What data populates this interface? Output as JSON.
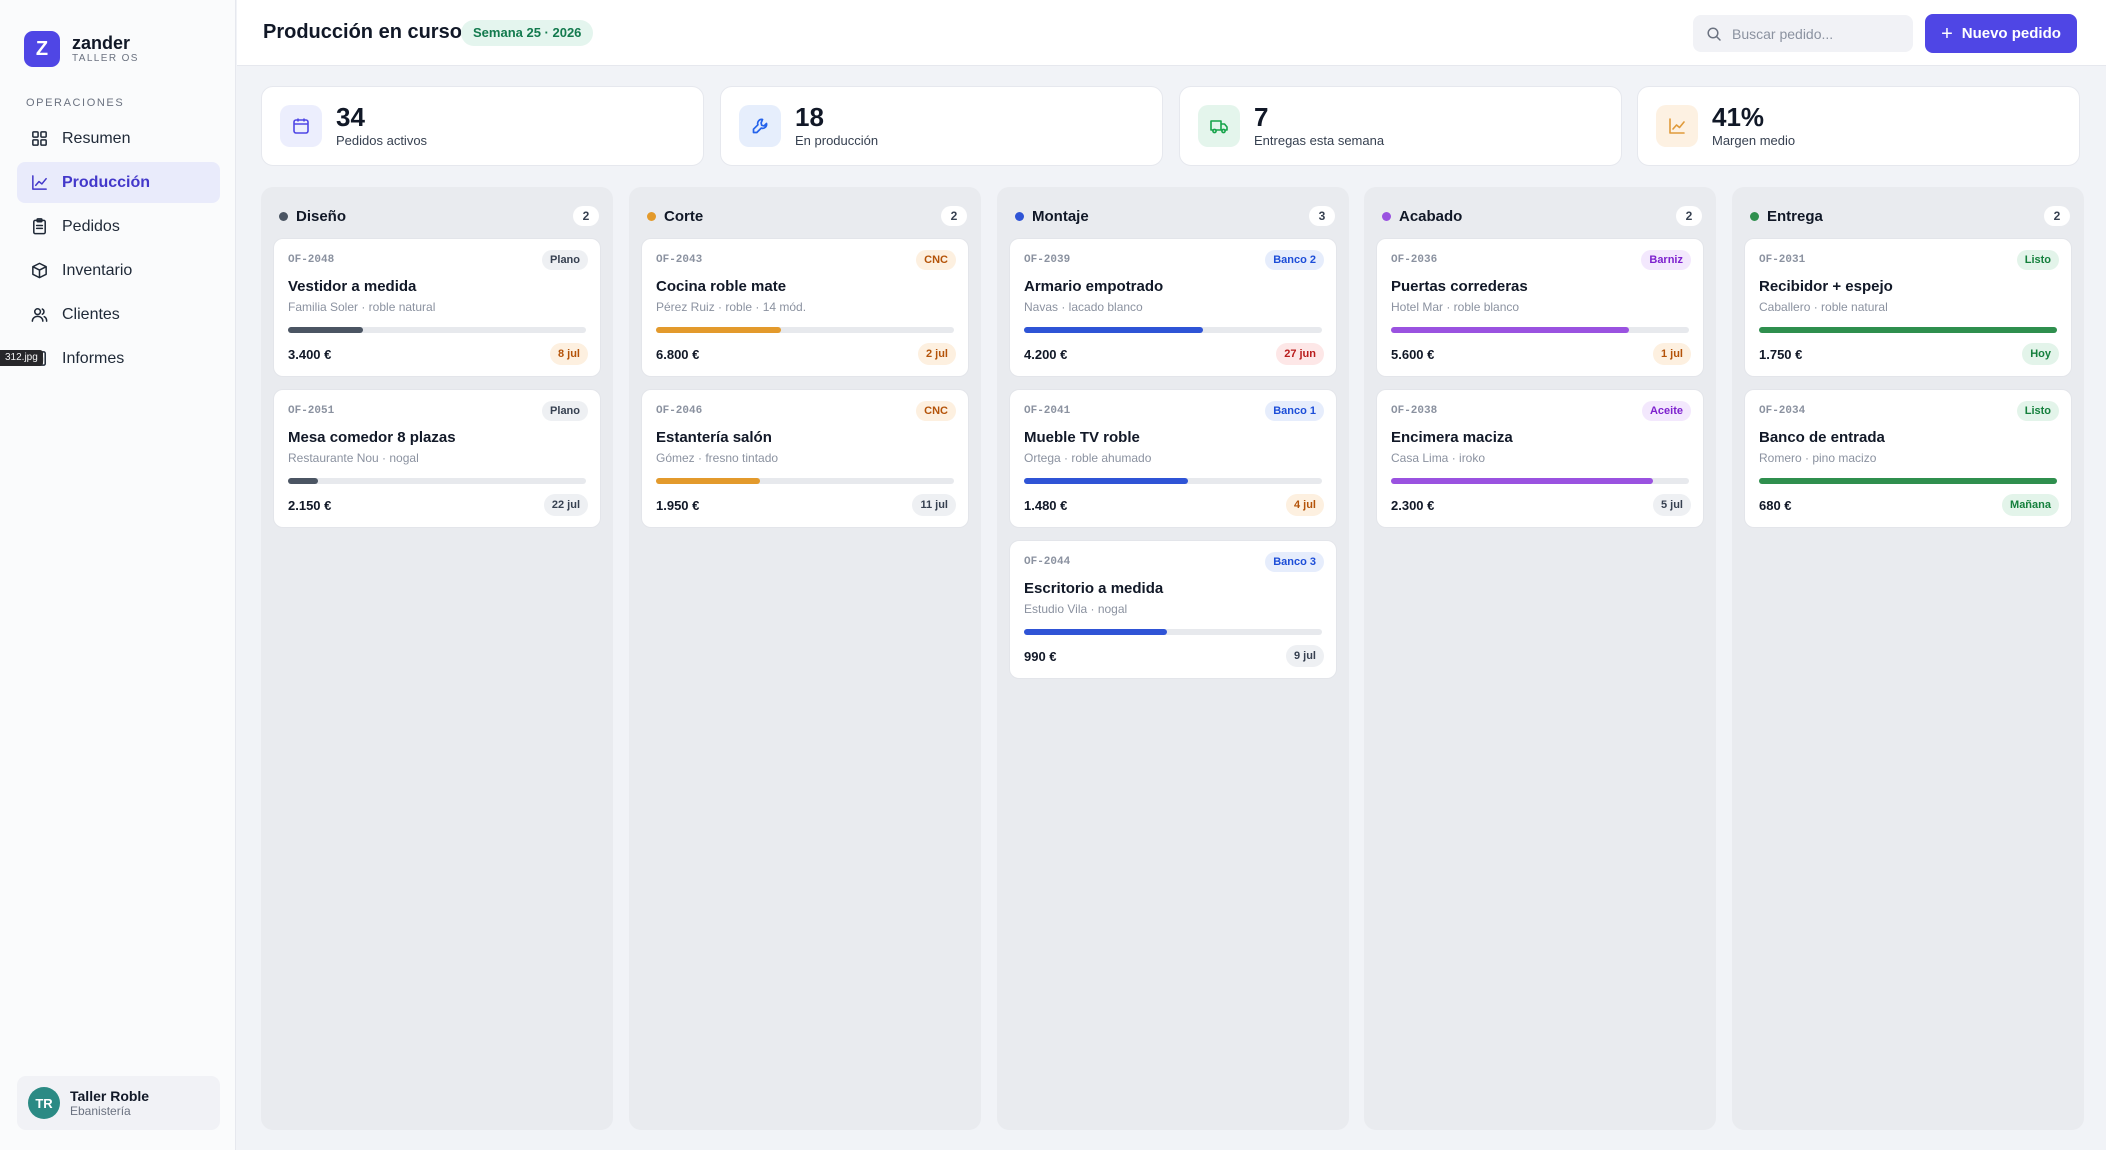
{
  "brand": {
    "name": "zander",
    "subtitle": "TALLER OS",
    "logo_letter": "Z"
  },
  "sidebar": {
    "section_label": "OPERACIONES",
    "items": [
      {
        "label": "Resumen",
        "icon": "grid-icon",
        "active": false
      },
      {
        "label": "Producción",
        "icon": "chart-line-icon",
        "active": true
      },
      {
        "label": "Pedidos",
        "icon": "clipboard-icon",
        "active": false
      },
      {
        "label": "Inventario",
        "icon": "box-icon",
        "active": false
      },
      {
        "label": "Clientes",
        "icon": "users-icon",
        "active": false
      },
      {
        "label": "Informes",
        "icon": "report-icon",
        "active": false
      }
    ],
    "file_tag": "312.jpg"
  },
  "user": {
    "initials": "TR",
    "name": "Taller Roble",
    "role": "Ebanistería"
  },
  "header": {
    "title": "Producción en curso",
    "week_badge": "Semana 25 · 2026",
    "search_placeholder": "Buscar pedido...",
    "new_button": "Nuevo pedido"
  },
  "stats": [
    {
      "value": "34",
      "label": "Pedidos activos",
      "icon": "calendar-icon",
      "bg": "#eceefd",
      "color": "#4f46e5"
    },
    {
      "value": "18",
      "label": "En producción",
      "icon": "wrench-icon",
      "bg": "#e6eefc",
      "color": "#2563eb"
    },
    {
      "value": "7",
      "label": "Entregas esta semana",
      "icon": "truck-icon",
      "bg": "#e4f5ec",
      "color": "#16a34a"
    },
    {
      "value": "41%",
      "label": "Margen medio",
      "icon": "trend-icon",
      "bg": "#fdf1e2",
      "color": "#e09a3a"
    }
  ],
  "columns": [
    {
      "title": "Diseño",
      "count": "2",
      "dot": "#4b5563",
      "bar": "#4b5563",
      "cards": [
        {
          "id": "OF-2048",
          "tag": "Plano",
          "tag_bg": "#eef0f3",
          "tag_color": "#374151",
          "title": "Vestidor a medida",
          "sub": "Familia Soler · roble natural",
          "progress": 25,
          "price": "3.400 €",
          "date": "8 jul",
          "date_bg": "#fdf0e0",
          "date_color": "#b45309"
        },
        {
          "id": "OF-2051",
          "tag": "Plano",
          "tag_bg": "#eef0f3",
          "tag_color": "#374151",
          "title": "Mesa comedor 8 plazas",
          "sub": "Restaurante Nou · nogal",
          "progress": 10,
          "price": "2.150 €",
          "date": "22 jul",
          "date_bg": "#eef0f3",
          "date_color": "#374151"
        }
      ]
    },
    {
      "title": "Corte",
      "count": "2",
      "dot": "#e39a2c",
      "bar": "#e39a2c",
      "cards": [
        {
          "id": "OF-2043",
          "tag": "CNC",
          "tag_bg": "#fdf0e0",
          "tag_color": "#b45309",
          "title": "Cocina roble mate",
          "sub": "Pérez Ruiz · roble · 14 mód.",
          "progress": 42,
          "price": "6.800 €",
          "date": "2 jul",
          "date_bg": "#fdf0e0",
          "date_color": "#b45309"
        },
        {
          "id": "OF-2046",
          "tag": "CNC",
          "tag_bg": "#fdf0e0",
          "tag_color": "#b45309",
          "title": "Estantería salón",
          "sub": "Gómez · fresno tintado",
          "progress": 35,
          "price": "1.950 €",
          "date": "11 jul",
          "date_bg": "#eef0f3",
          "date_color": "#374151"
        }
      ]
    },
    {
      "title": "Montaje",
      "count": "3",
      "dot": "#2f54d6",
      "bar": "#2f54d6",
      "cards": [
        {
          "id": "OF-2039",
          "tag": "Banco 2",
          "tag_bg": "#e6edfc",
          "tag_color": "#1d4ed8",
          "title": "Armario empotrado",
          "sub": "Navas · lacado blanco",
          "progress": 60,
          "price": "4.200 €",
          "date": "27 jun",
          "date_bg": "#fde7e7",
          "date_color": "#b91c1c"
        },
        {
          "id": "OF-2041",
          "tag": "Banco 1",
          "tag_bg": "#e6edfc",
          "tag_color": "#1d4ed8",
          "title": "Mueble TV roble",
          "sub": "Ortega · roble ahumado",
          "progress": 55,
          "price": "1.480 €",
          "date": "4 jul",
          "date_bg": "#fdf0e0",
          "date_color": "#b45309"
        },
        {
          "id": "OF-2044",
          "tag": "Banco 3",
          "tag_bg": "#e6edfc",
          "tag_color": "#1d4ed8",
          "title": "Escritorio a medida",
          "sub": "Estudio Vila · nogal",
          "progress": 48,
          "price": "990 €",
          "date": "9 jul",
          "date_bg": "#eef0f3",
          "date_color": "#374151"
        }
      ]
    },
    {
      "title": "Acabado",
      "count": "2",
      "dot": "#9a52e0",
      "bar": "#9a52e0",
      "cards": [
        {
          "id": "OF-2036",
          "tag": "Barniz",
          "tag_bg": "#f3e8fd",
          "tag_color": "#7e22ce",
          "title": "Puertas correderas",
          "sub": "Hotel Mar · roble blanco",
          "progress": 80,
          "price": "5.600 €",
          "date": "1 jul",
          "date_bg": "#fdf0e0",
          "date_color": "#b45309"
        },
        {
          "id": "OF-2038",
          "tag": "Aceite",
          "tag_bg": "#f3e8fd",
          "tag_color": "#7e22ce",
          "title": "Encimera maciza",
          "sub": "Casa Lima · iroko",
          "progress": 88,
          "price": "2.300 €",
          "date": "5 jul",
          "date_bg": "#eef0f3",
          "date_color": "#374151"
        }
      ]
    },
    {
      "title": "Entrega",
      "count": "2",
      "dot": "#2f8f4e",
      "bar": "#2f8f4e",
      "cards": [
        {
          "id": "OF-2031",
          "tag": "Listo",
          "tag_bg": "#e3f4ea",
          "tag_color": "#15803d",
          "title": "Recibidor + espejo",
          "sub": "Caballero · roble natural",
          "progress": 100,
          "price": "1.750 €",
          "date": "Hoy",
          "date_bg": "#e3f4ea",
          "date_color": "#15803d"
        },
        {
          "id": "OF-2034",
          "tag": "Listo",
          "tag_bg": "#e3f4ea",
          "tag_color": "#15803d",
          "title": "Banco de entrada",
          "sub": "Romero · pino macizo",
          "progress": 100,
          "price": "680 €",
          "date": "Mañana",
          "date_bg": "#e3f4ea",
          "date_color": "#15803d"
        }
      ]
    }
  ]
}
